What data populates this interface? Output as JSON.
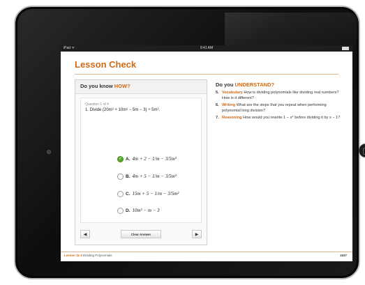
{
  "status_bar": {
    "carrier": "iPad ᯤ",
    "time": "9:41 AM"
  },
  "page": {
    "title": "Lesson Check"
  },
  "left_panel": {
    "header_prefix": "Do you know ",
    "header_accent": "HOW?",
    "question_number": "Question 1 of 4",
    "question": "1. Divide (20m³ + 10m² − 5m − 3) ÷ 5m².",
    "choices": [
      {
        "letter": "A.",
        "expr": "4m + 2 − 1/m − 3/5m²",
        "selected": true
      },
      {
        "letter": "B.",
        "expr": "4m + 5 − 1/m − 3/5m²",
        "selected": false
      },
      {
        "letter": "C.",
        "expr": "15m + 5 − 1/m − 3/5m²",
        "selected": false
      },
      {
        "letter": "D.",
        "expr": "10m² − m − 3",
        "selected": false
      }
    ],
    "prev_label": "◀",
    "clear_label": "Clear Answer",
    "next_label": "▶"
  },
  "right_panel": {
    "header_prefix": "Do you ",
    "header_accent": "UNDERSTAND?",
    "items": [
      {
        "num": "5.",
        "keyword": "Vocabulary",
        "text": "How is dividing polynomials like dividing real numbers? How is it different?"
      },
      {
        "num": "6.",
        "keyword": "Writing",
        "text": "What are the steps that you repeat when performing polynomial long division?"
      },
      {
        "num": "7.",
        "keyword": "Reasoning",
        "text": "How would you rewrite 1 − x⁴ before dividing it by x − 1?"
      }
    ]
  },
  "footer": {
    "lesson": "Lesson 11-3",
    "lesson_title": "Dividing Polynomials",
    "page_number": "1637"
  },
  "colors": {
    "accent": "#cf6a16",
    "selected": "#5aaa2e"
  }
}
